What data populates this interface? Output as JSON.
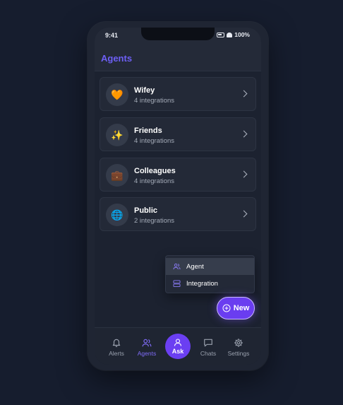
{
  "status": {
    "time": "9:41",
    "battery": "100%"
  },
  "header": {
    "title": "Agents"
  },
  "agents": [
    {
      "name": "Wifey",
      "subtitle": "4 integrations",
      "emoji": "🧡",
      "icon": "orange-heart-icon"
    },
    {
      "name": "Friends",
      "subtitle": "4 integrations",
      "emoji": "✨",
      "icon": "sparkles-icon"
    },
    {
      "name": "Colleagues",
      "subtitle": "4 integrations",
      "emoji": "💼",
      "icon": "briefcase-icon"
    },
    {
      "name": "Public",
      "subtitle": "2 integrations",
      "emoji": "🌐",
      "icon": "globe-icon"
    }
  ],
  "menu": {
    "items": [
      {
        "label": "Agent",
        "icon": "users-icon"
      },
      {
        "label": "Integration",
        "icon": "server-icon"
      }
    ]
  },
  "new_button": {
    "label": "New",
    "icon": "plus-circle-icon"
  },
  "tabs": [
    {
      "label": "Alerts",
      "icon": "bell-icon"
    },
    {
      "label": "Agents",
      "icon": "users-icon"
    },
    {
      "label": "Ask",
      "icon": "user-icon"
    },
    {
      "label": "Chats",
      "icon": "chat-icon"
    },
    {
      "label": "Settings",
      "icon": "gear-icon"
    }
  ],
  "colors": {
    "accent": "#6b3ff2",
    "title": "#6d5ff5",
    "background": "#161d2e",
    "card": "#232937"
  }
}
